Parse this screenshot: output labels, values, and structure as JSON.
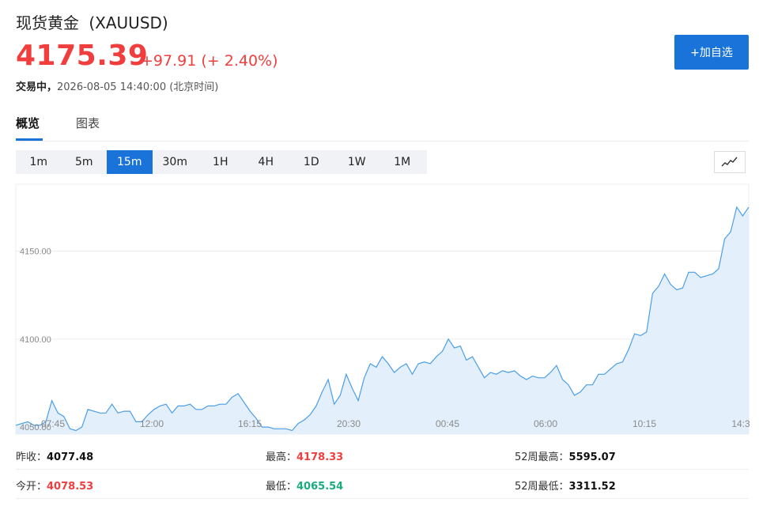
{
  "header": {
    "name": "现货黄金",
    "symbol": "(XAUUSD)",
    "price": "4175.39",
    "change": "+97.91 (+ 2.40%)",
    "status_prefix": "交易中，",
    "status_time": "2026-08-05 14:40:00 (北京时间)",
    "add_button": "+加自选"
  },
  "tabs": [
    "概览",
    "图表"
  ],
  "timeframes": {
    "items": [
      "1m",
      "5m",
      "15m",
      "30m",
      "1H",
      "4H",
      "1D",
      "1W",
      "1M"
    ],
    "active": "15m"
  },
  "colors": {
    "accent": "#1a73d9",
    "up": "#f03e3e",
    "down": "#1aab7f",
    "line": "#4a9ee8",
    "area": "#e3f0fb"
  },
  "chart_data": {
    "type": "area",
    "x_tick_labels": [
      "07:45",
      "12:00",
      "16:15",
      "20:30",
      "00:45",
      "06:00",
      "10:15",
      "14:3"
    ],
    "y_tick_labels": [
      "4150.00",
      "4100.00",
      "4050.00"
    ],
    "y_ticks": [
      4150,
      4100,
      4050
    ],
    "ylim": [
      4046,
      4188
    ],
    "grid": true,
    "values": [
      4051,
      4052,
      4053,
      4051,
      4051,
      4053,
      4065,
      4058,
      4056,
      4049,
      4048,
      4050,
      4060,
      4059,
      4058,
      4058,
      4063,
      4058,
      4059,
      4059,
      4053,
      4053,
      4057,
      4060,
      4062,
      4063,
      4058,
      4062,
      4062,
      4063,
      4060,
      4060,
      4062,
      4062,
      4063,
      4063,
      4067,
      4069,
      4064,
      4059,
      4055,
      4050,
      4050,
      4049,
      4049,
      4049,
      4048,
      4052,
      4054,
      4057,
      4062,
      4070,
      4077,
      4063,
      4068,
      4080,
      4072,
      4065,
      4078,
      4086,
      4084,
      4090,
      4086,
      4081,
      4084,
      4086,
      4080,
      4086,
      4087,
      4086,
      4090,
      4093,
      4100,
      4095,
      4096,
      4088,
      4090,
      4084,
      4078,
      4081,
      4080,
      4082,
      4081,
      4082,
      4079,
      4077,
      4079,
      4078,
      4078,
      4081,
      4085,
      4077,
      4074,
      4068,
      4070,
      4074,
      4074,
      4080,
      4080,
      4083,
      4086,
      4087,
      4094,
      4103,
      4102,
      4104,
      4126,
      4130,
      4137,
      4131,
      4128,
      4129,
      4138,
      4138,
      4135,
      4136,
      4137,
      4140,
      4157,
      4161,
      4175,
      4170,
      4175
    ]
  },
  "stats": [
    [
      {
        "label": "昨收：",
        "value": "4077.48",
        "tone": "neutral"
      },
      {
        "label": "最高：",
        "value": "4178.33",
        "tone": "up"
      },
      {
        "label": "52周最高：",
        "value": "5595.07",
        "tone": "neutral"
      }
    ],
    [
      {
        "label": "今开：",
        "value": "4078.53",
        "tone": "up"
      },
      {
        "label": "最低：",
        "value": "4065.54",
        "tone": "down"
      },
      {
        "label": "52周最低：",
        "value": "3311.52",
        "tone": "neutral"
      }
    ]
  ]
}
